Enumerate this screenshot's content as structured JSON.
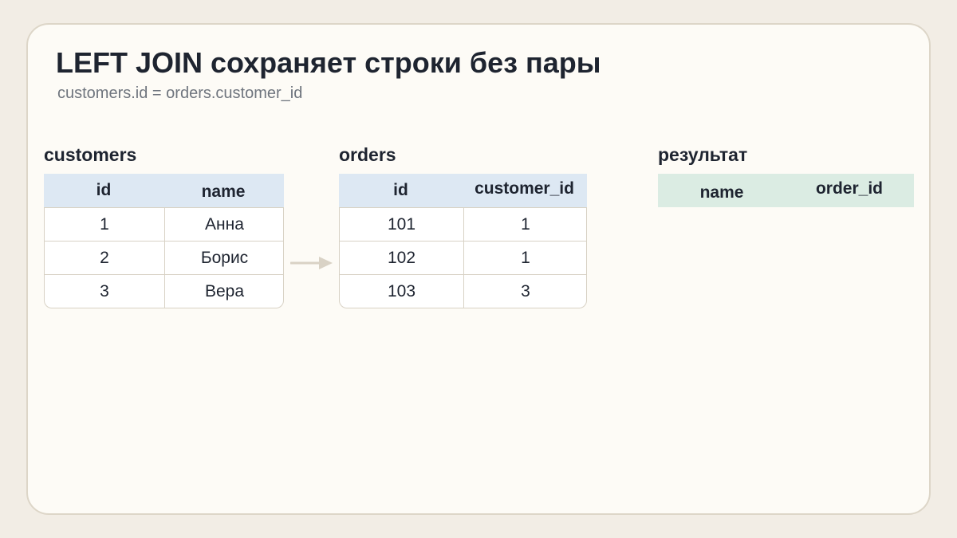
{
  "title": "LEFT JOIN сохраняет строки без пары",
  "subtitle": "customers.id = orders.customer_id",
  "colors": {
    "page_background": "#f2ede5",
    "card_background": "#fdfbf6",
    "source_header": "#dde8f3",
    "result_header": "#dbece3",
    "arrow": "#d9d2c5"
  },
  "customers": {
    "label": "customers",
    "columns": [
      "id",
      "name"
    ],
    "rows": [
      [
        "1",
        "Анна"
      ],
      [
        "2",
        "Борис"
      ],
      [
        "3",
        "Вера"
      ]
    ]
  },
  "orders": {
    "label": "orders",
    "columns": [
      "id",
      "customer_id"
    ],
    "rows": [
      [
        "101",
        "1"
      ],
      [
        "102",
        "1"
      ],
      [
        "103",
        "3"
      ]
    ]
  },
  "result": {
    "label": "результат",
    "columns": [
      "name",
      "order_id"
    ],
    "rows": []
  },
  "icons": {
    "join_arrow": "arrow-right-icon"
  }
}
